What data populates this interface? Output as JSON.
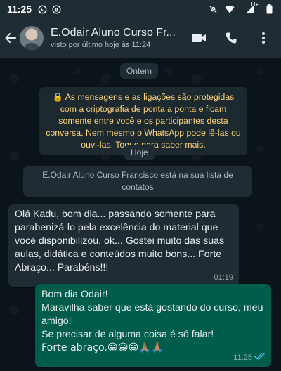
{
  "status_bar": {
    "time": "11:25",
    "network_label": "H+"
  },
  "header": {
    "contact_name": "E.Odair Aluno Curso Fr...",
    "last_seen": "visto por último hoje às 11:24"
  },
  "chat": {
    "date_label_1": "Ontem",
    "encryption_notice": "🔒 As mensagens e as ligações são protegidas com a criptografia de ponta a ponta e ficam somente entre você e os participantes desta conversa. Nem mesmo o WhatsApp pode lê-las ou ouvi-las. Toque para saber mais.",
    "date_label_2": "Hoje",
    "contact_notice": "E.Odair Aluno Curso Francisco está na sua lista de contatos",
    "messages": [
      {
        "direction": "incoming",
        "text": "Olá Kadu, bom dia... passando somente para parabenizá-lo pela excelência do material que você disponibilizou, ok... Gostei muito das suas aulas,  didática e conteúdos muito bons... Forte Abraço... Parabéns!!!",
        "time": "01:19"
      },
      {
        "direction": "outgoing",
        "lines": [
          "Bom dia Odair!",
          "Maravilha saber que está gostando do curso, meu amigo!",
          "Se precisar de alguma coisa é só falar!",
          "Forte abraço.😀😀😀🙏🏽🙏🏽"
        ],
        "time": "11:25",
        "status": "read"
      }
    ]
  },
  "colors": {
    "app_bar": "#1f2c33",
    "chat_background": "#0b1418",
    "incoming_bubble": "#1f2c33",
    "outgoing_bubble": "#005c4b",
    "encryption_text": "#ffd279",
    "read_ticks": "#53bdeb"
  },
  "icons": [
    "whatsapp-icon",
    "b-icon",
    "mute-icon",
    "wifi-icon",
    "signal-icon",
    "battery-icon",
    "back-arrow-icon",
    "video-call-icon",
    "voice-call-icon",
    "more-options-icon",
    "lock-icon",
    "double-check-icon"
  ]
}
